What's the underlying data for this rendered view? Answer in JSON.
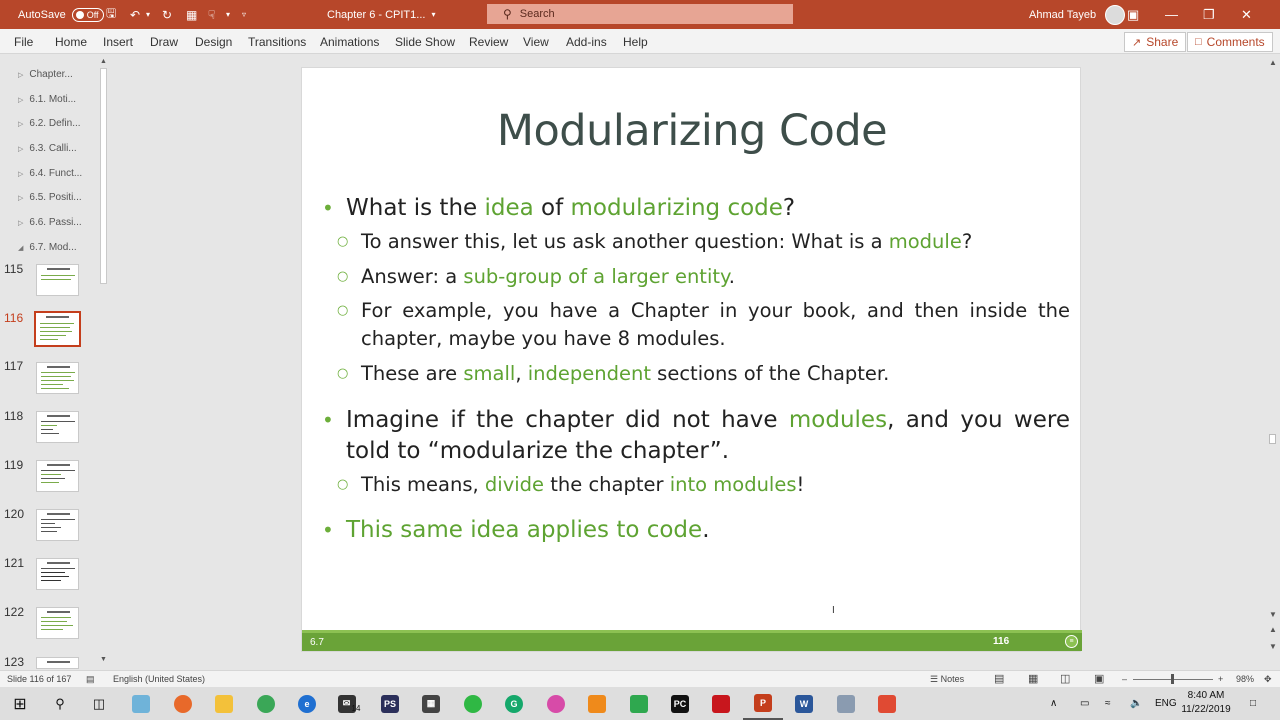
{
  "titlebar": {
    "autosave_label": "AutoSave",
    "autosave_state": "Off",
    "doc_title": "Chapter 6 - CPIT1...",
    "search_placeholder": "Search",
    "user_name": "Ahmad Tayeb"
  },
  "ribbon": {
    "tabs": [
      "File",
      "Home",
      "Insert",
      "Draw",
      "Design",
      "Transitions",
      "Animations",
      "Slide Show",
      "Review",
      "View",
      "Add-ins",
      "Help"
    ],
    "share_label": "Share",
    "comments_label": "Comments"
  },
  "leftpane": {
    "sections": [
      "Chapter...",
      "6.1. Moti...",
      "6.2. Defin...",
      "6.3. Calli...",
      "6.4. Funct...",
      "6.5. Positi...",
      "6.6. Passi...",
      "6.7. Mod..."
    ],
    "slide_numbers": [
      "115",
      "116",
      "117",
      "118",
      "119",
      "120",
      "121",
      "122",
      "123"
    ],
    "active_slide": "116"
  },
  "slide": {
    "title": "Modularizing Code",
    "footer_section": "6.7",
    "footer_number": "116",
    "b1": {
      "t1": "What is the ",
      "g1": "idea",
      "t2": " of ",
      "g2": "modularizing code",
      "t3": "?"
    },
    "s1": {
      "t1": "To answer this, let us ask another question: What is a ",
      "g1": "module",
      "t2": "?"
    },
    "s2": {
      "t1": "Answer: a ",
      "g1": "sub-group of a larger entity",
      "t2": "."
    },
    "s3": {
      "t1": "For example, you have a Chapter in your book, and then inside the chapter, maybe you have 8 modules."
    },
    "s4": {
      "t1": "These are ",
      "g1": "small",
      "t2": ", ",
      "g2": "independent",
      "t3": " sections of the Chapter."
    },
    "b2": {
      "t1": "Imagine if the chapter did not have ",
      "g1": "modules",
      "t2": ", and you were told to “modularize the chapter”."
    },
    "s5": {
      "t1": "This means, ",
      "g1": "divide",
      "t2": " the chapter ",
      "g2": "into modules",
      "t3": "!"
    },
    "b3": {
      "g1": "This same idea applies to code",
      "t1": "."
    }
  },
  "statusbar": {
    "slide_info": "Slide 116 of 167",
    "language": "English (United States)",
    "notes_label": "Notes",
    "zoom": "98%"
  },
  "taskbar": {
    "time": "8:40 AM",
    "date": "11/22/2019",
    "lang": "ENG",
    "mail_badge": "14"
  },
  "colors": {
    "accent": "#b7472a",
    "slide_green": "#6aa338",
    "title_text": "#3e4e4a"
  }
}
